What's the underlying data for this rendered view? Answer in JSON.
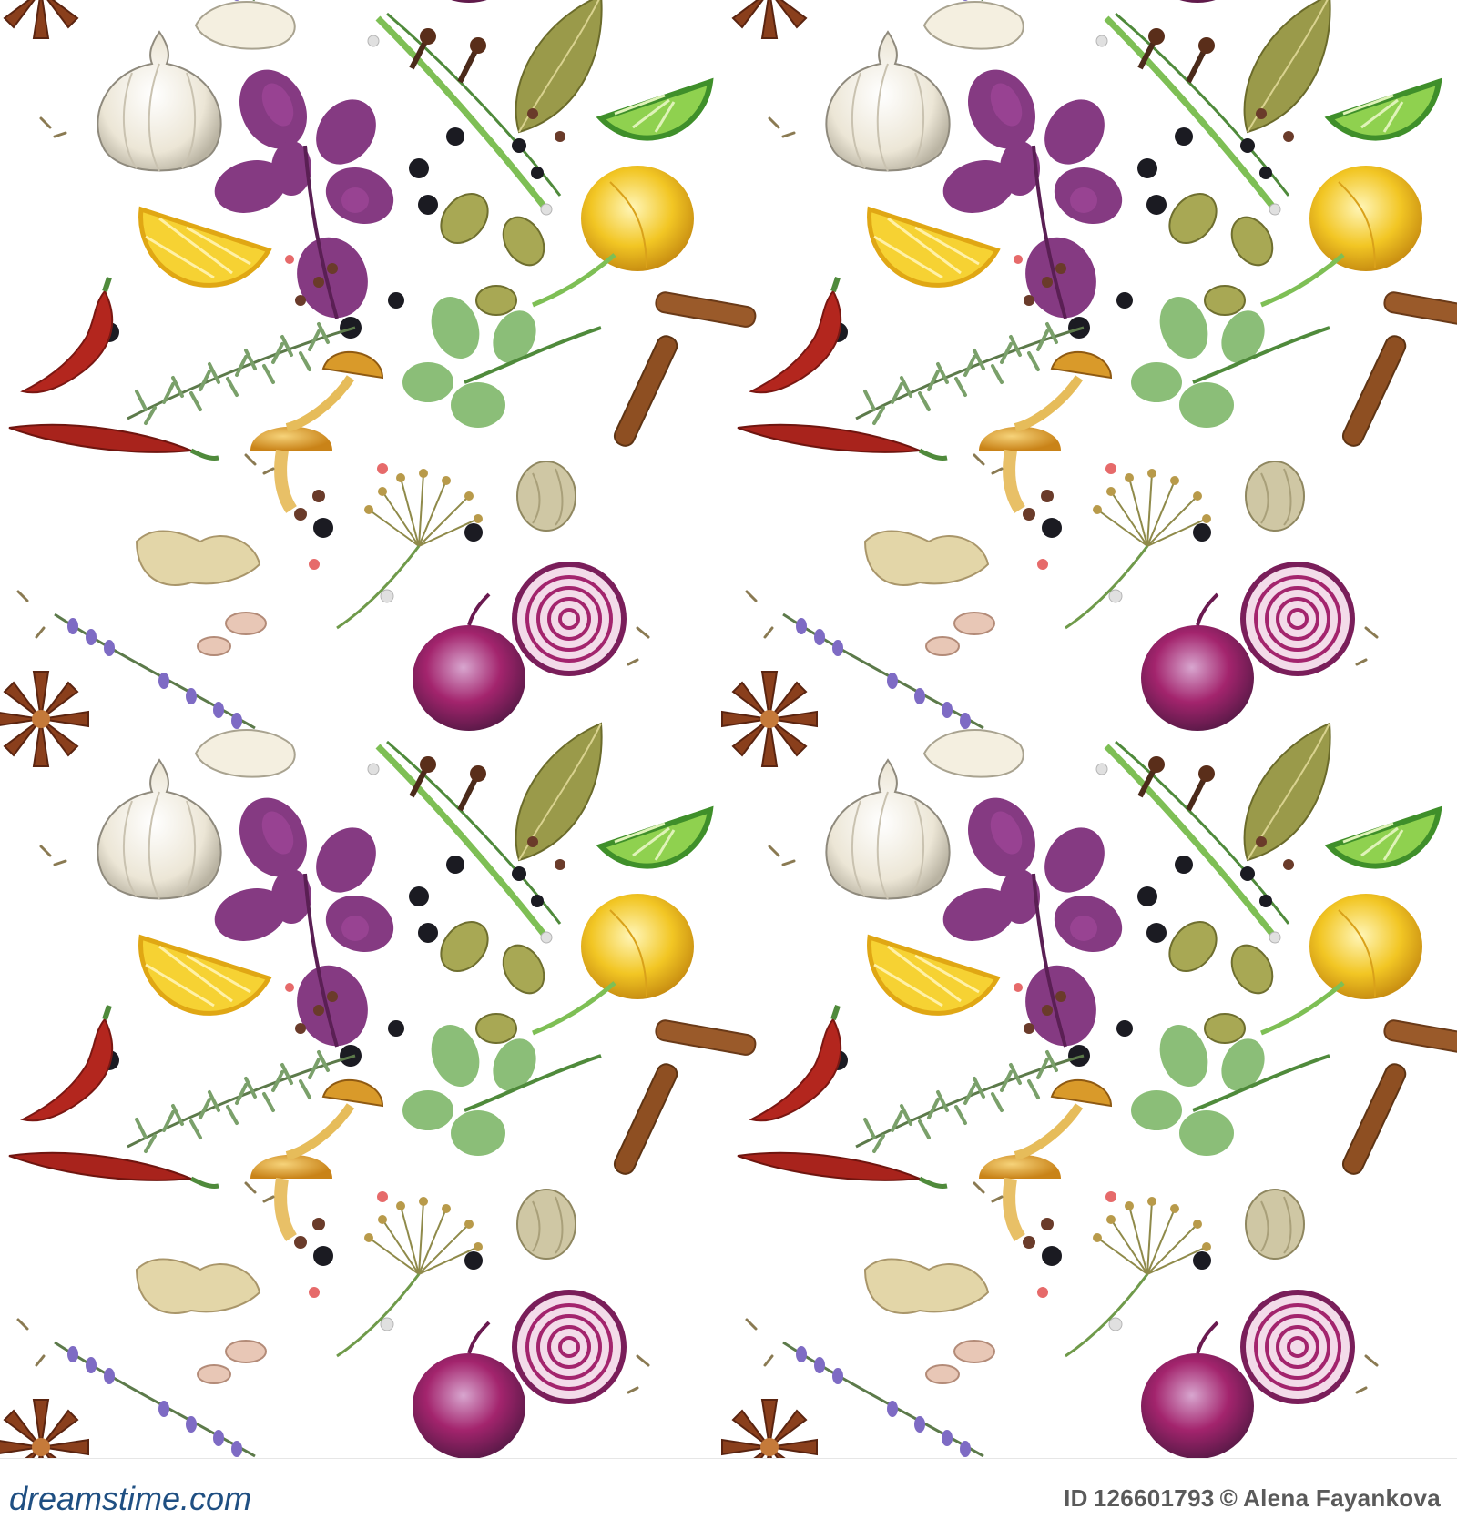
{
  "image": {
    "subject": "seamless watercolor pattern of herbs and spices",
    "background_color": "#ffffff",
    "item_icons": [
      "star-anise-icon",
      "garlic-bulb-icon",
      "garlic-clove-icon",
      "purple-basil-icon",
      "green-onion-icon",
      "clove-icon",
      "bay-leaf-icon",
      "lime-slice-icon",
      "lemon-slice-icon",
      "yellow-onion-icon",
      "cardamom-pod-icon",
      "peppercorn-icon",
      "red-chili-icon",
      "cinnamon-stick-icon",
      "rosemary-sprig-icon",
      "green-basil-icon",
      "mushroom-icon",
      "nutmeg-icon",
      "ginger-root-icon",
      "dill-umbel-icon",
      "red-onion-icon",
      "lavender-sprig-icon",
      "cumin-seed-icon"
    ],
    "palette": {
      "purple": "#7b2a78",
      "magenta_onion": "#a3246d",
      "lemon": "#f2c624",
      "lime": "#8fd14f",
      "chili_red": "#b3261e",
      "leaf_green": "#4f8a3b",
      "bay_olive": "#9a9a4a",
      "cinnamon": "#9a5a2a",
      "garlic": "#ece6d6",
      "pepper_black": "#1b1b22",
      "lavender": "#7e6bc4"
    }
  },
  "footer": {
    "logo_text": "dreamstime.com",
    "id_label": "ID",
    "id_value": "126601793",
    "copyright_symbol": "©",
    "author": "Alena Fayankova"
  }
}
